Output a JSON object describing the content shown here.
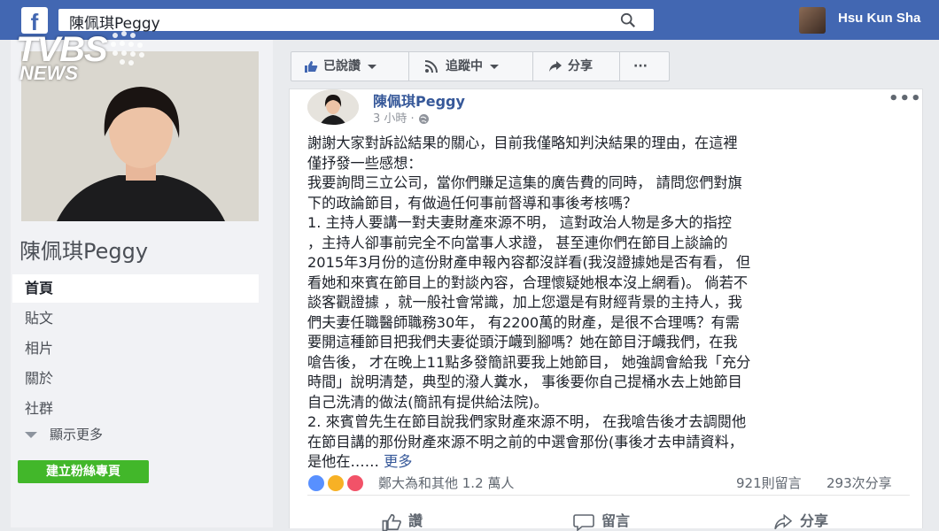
{
  "topbar": {
    "logo": "f",
    "search_value": "陳佩琪Peggy",
    "user_name": "Hsu Kun Sha"
  },
  "watermark": {
    "brand": "TVBS",
    "sub": "NEWS"
  },
  "profile": {
    "name": "陳佩琪Peggy",
    "nav": [
      "首頁",
      "貼文",
      "相片",
      "關於",
      "社群"
    ],
    "show_more": "顯示更多",
    "create_page": "建立粉絲專頁"
  },
  "actions": {
    "liked": "已說讚",
    "following": "追蹤中",
    "share": "分享",
    "more": "···"
  },
  "post": {
    "author": "陳佩琪Peggy",
    "time": "3 小時 ·",
    "menu": "•••",
    "body": "謝謝大家對訴訟結果的關心，目前我僅略知判決結果的理由，在這裡\n僅抒發一些感想：\n我要詢問三立公司，當你們賺足這集的廣告費的同時， 請問您們對旗\n下的政論節目，有做過任何事前督導和事後考核嗎？\n1. 主持人要講一對夫妻財產來源不明， 這對政治人物是多大的指控\n，主持人卻事前完全不向當事人求證， 甚至連你們在節目上談論的\n2015年3月份的這份財產申報內容都沒詳看(我沒證據她是否有看， 但\n看她和來賓在節目上的對談內容，合理懷疑她根本沒上網看)。 倘若不\n談客觀證據 ，就一般社會常識，加上您還是有財經背景的主持人，我\n們夫妻任職醫師職務30年， 有2200萬的財產，是很不合理嗎？有需\n要開這種節目把我們夫妻從頭汙衊到腳嗎？她在節目汙衊我們，在我\n嗆告後， 才在晚上11點多發簡訊要我上她節目， 她強調會給我「充分\n時間」說明清楚，典型的潑人糞水， 事後要你自己提桶水去上她節目\n自己洗清的做法(簡訊有提供給法院)。\n2. 來賓曾先生在節目說我們家財產來源不明， 在我嗆告後才去調閱他\n在節目講的那份財產來源不明之前的中選會那份(事後才去申請資料，\n是他在…… ",
    "more_link": "更多",
    "reaction_text": "鄭大為和其他 1.2 萬人",
    "comments": "921則留言",
    "shares": "293次分享",
    "like_btn": "讚",
    "comment_btn": "留言",
    "share_btn": "分享"
  },
  "colors": {
    "brand_blue": "#4267b2",
    "link": "#365899",
    "green": "#42b72a"
  }
}
